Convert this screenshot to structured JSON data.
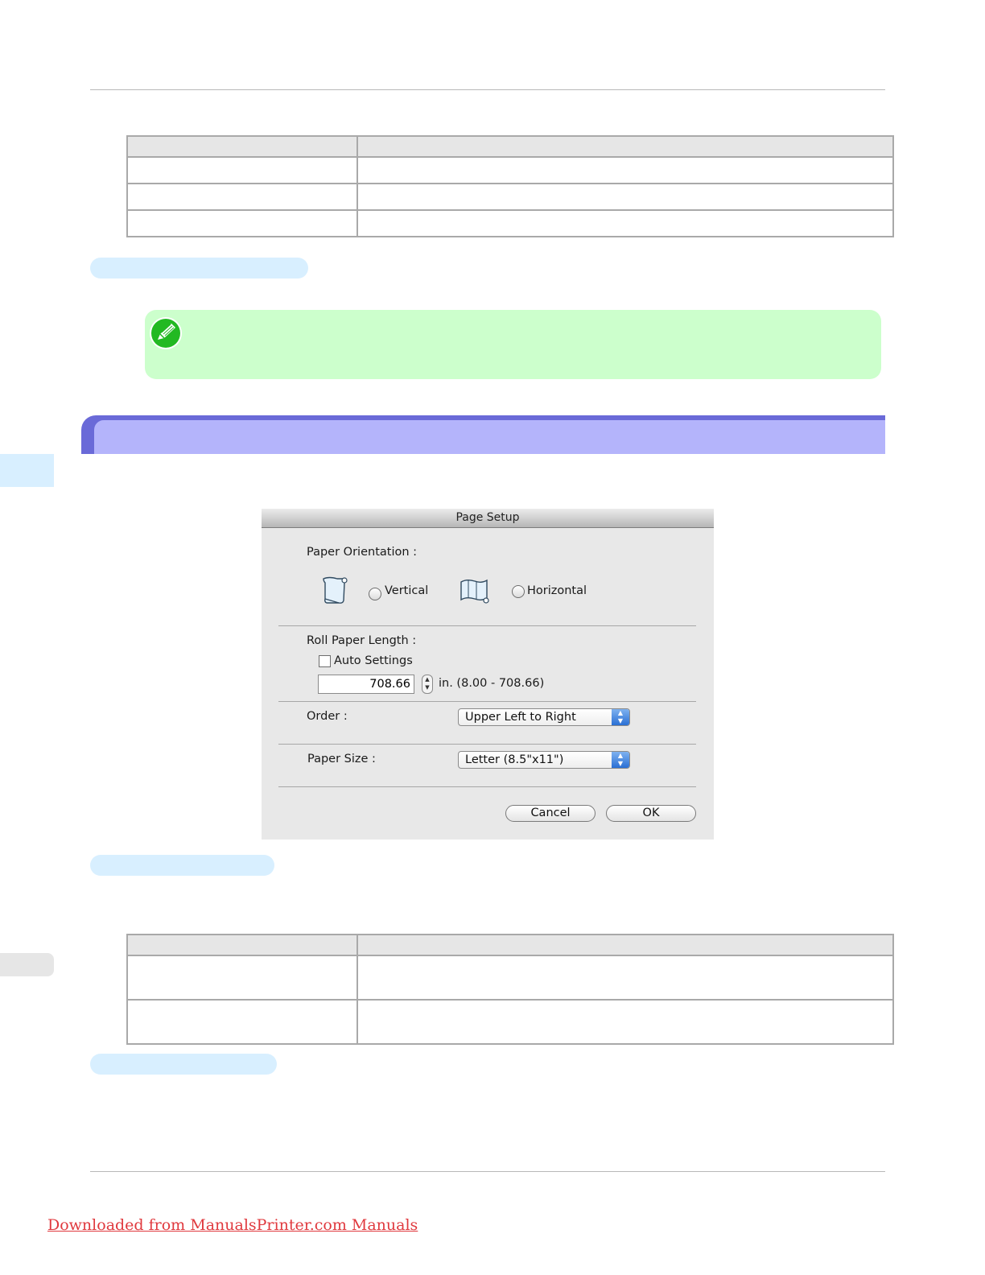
{
  "dialog": {
    "title": "Page Setup",
    "orientation": {
      "label": "Paper Orientation :",
      "vertical_label": "Vertical",
      "horizontal_label": "Horizontal",
      "selected": "none"
    },
    "roll_paper_length": {
      "label": "Roll Paper Length :",
      "auto_settings_label": "Auto Settings",
      "auto_settings_checked": false,
      "value": "708.66",
      "range_text": "in. (8.00 - 708.66)"
    },
    "order": {
      "label": "Order :",
      "value": "Upper Left to Right"
    },
    "paper_size": {
      "label": "Paper Size :",
      "value": "Letter (8.5\"x11\")"
    },
    "buttons": {
      "cancel": "Cancel",
      "ok": "OK"
    }
  },
  "footer": {
    "link_text": "Downloaded from ManualsPrinter.com Manuals"
  },
  "colors": {
    "section_bar": "#b4b4fb",
    "note_background": "#ccffcc",
    "pill": "#d8efff",
    "side_tab": "#d8efff",
    "footer_link": "#e0393e",
    "popup_arrow": "#2a6fd4"
  },
  "icons": {
    "note": "pencil-note-icon",
    "vertical": "vertical-roll-icon",
    "horizontal": "horizontal-roll-icon"
  }
}
